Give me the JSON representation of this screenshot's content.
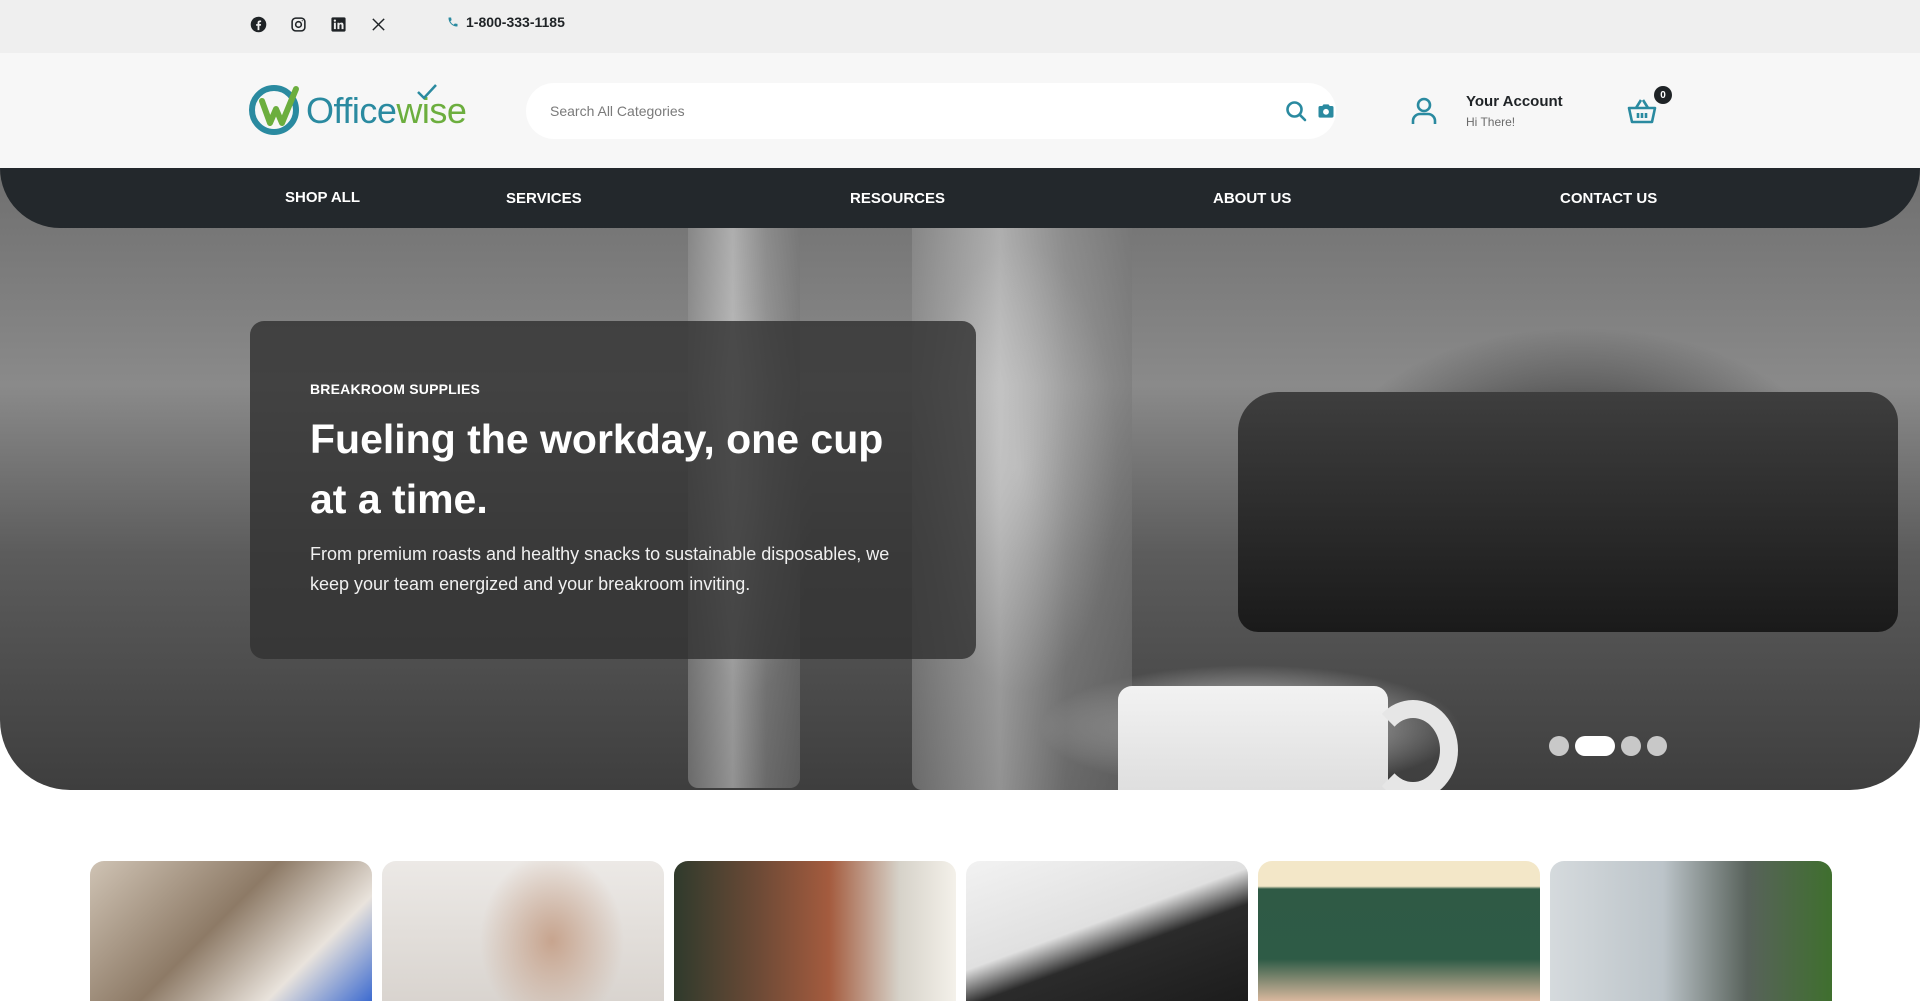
{
  "topbar": {
    "social": [
      "facebook-icon",
      "instagram-icon",
      "linkedin-icon",
      "x-icon"
    ],
    "phone": "1-800-333-1185"
  },
  "header": {
    "logo_part1": "Office",
    "logo_part2": "wise",
    "search_placeholder": "Search All Categories",
    "account_title": "Your Account",
    "account_greeting": "Hi There!",
    "cart_count": "0"
  },
  "nav": {
    "items": [
      "SHOP ALL",
      "SERVICES",
      "RESOURCES",
      "ABOUT US",
      "CONTACT US"
    ]
  },
  "hero": {
    "eyebrow": "BREAKROOM SUPPLIES",
    "headline": "Fueling the workday, one cup at a time.",
    "description": "From premium roasts and healthy snacks to sustainable disposables, we keep your team energized and your breakroom inviting.",
    "slide_count": 4,
    "active_slide": 2
  },
  "colors": {
    "brand_teal": "#2a8aa0",
    "brand_green": "#6cae3e",
    "nav_dark": "#23282c"
  }
}
